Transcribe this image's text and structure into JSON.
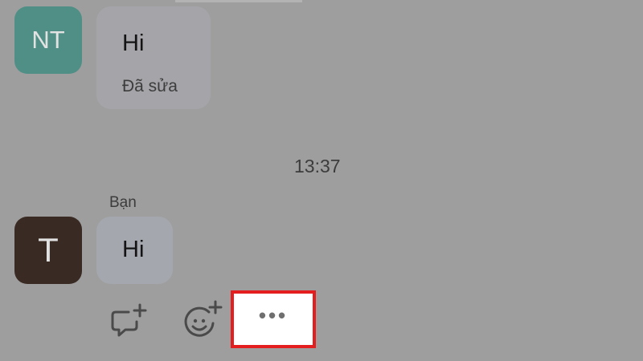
{
  "messages": [
    {
      "avatar_initials": "NT",
      "avatar_color": "#4f8f85",
      "text": "Hi",
      "edited_label": "Đã sửa"
    },
    {
      "avatar_initials": "T",
      "avatar_color": "#3a2a24",
      "sender_label": "Bạn",
      "text": "Hi"
    }
  ],
  "time_separator": "13:37",
  "actions": {
    "reply_icon": "reply-plus-icon",
    "react_icon": "emoji-plus-icon",
    "more_label": "•••",
    "highlight_color": "#e41e1e"
  }
}
